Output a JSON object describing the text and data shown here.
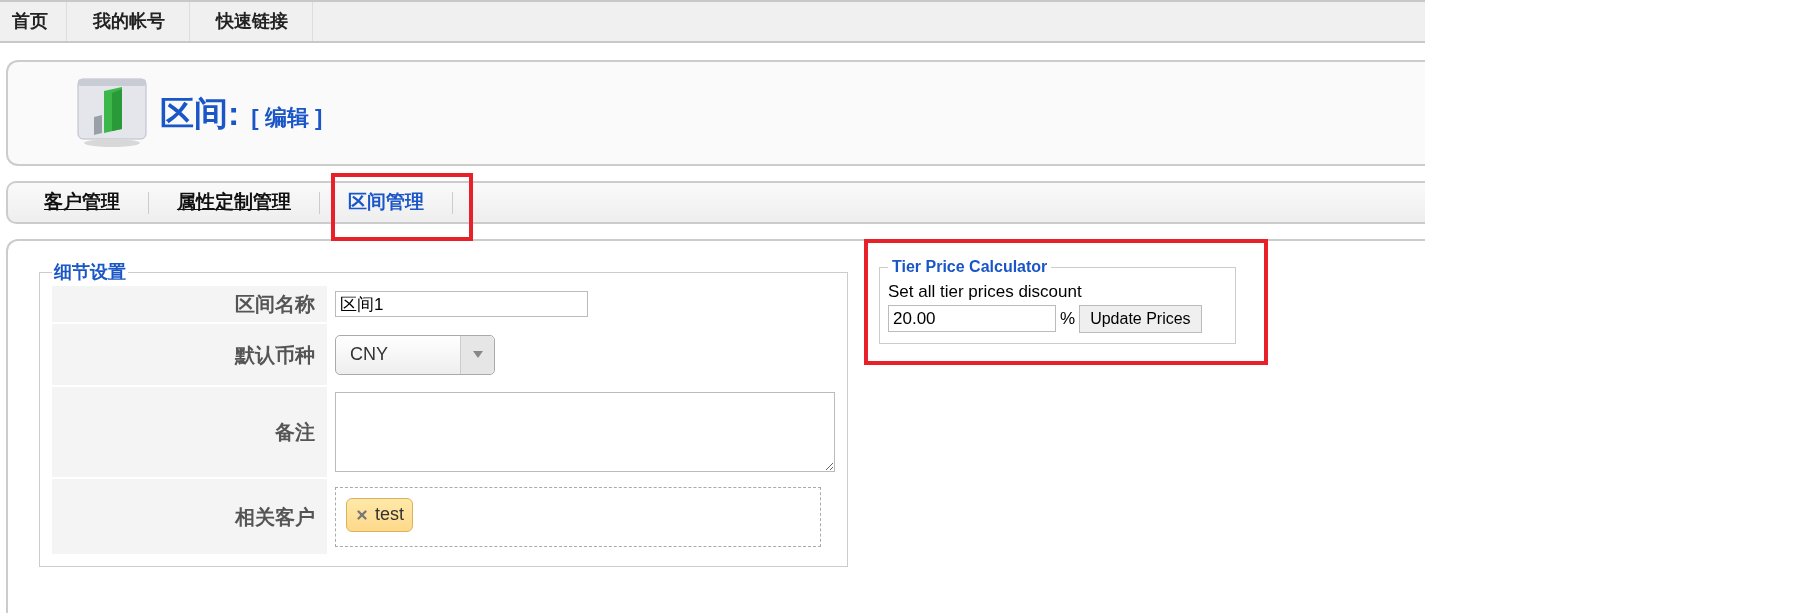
{
  "top_nav": [
    {
      "label": "首页"
    },
    {
      "label": "我的帐号"
    },
    {
      "label": "快速链接"
    }
  ],
  "header": {
    "title": "区间:",
    "action": "[ 编辑 ]"
  },
  "tabs": [
    {
      "label": "客户管理",
      "selected": false
    },
    {
      "label": "属性定制管理",
      "selected": false
    },
    {
      "label": "区间管理",
      "selected": true
    }
  ],
  "details": {
    "legend": "细节设置",
    "fields": [
      {
        "kind": "text",
        "label": "区间名称",
        "value": "区间1"
      },
      {
        "kind": "select",
        "label": "默认币种",
        "value": "CNY"
      },
      {
        "kind": "textarea",
        "label": "备注"
      },
      {
        "kind": "tags",
        "label": "相关客户",
        "tags": [
          {
            "label": "test"
          }
        ]
      }
    ]
  },
  "calculator": {
    "legend": "Tier Price Calculator",
    "description": "Set all tier prices discount",
    "value": "20.00",
    "unit": "%",
    "button": "Update Prices"
  }
}
